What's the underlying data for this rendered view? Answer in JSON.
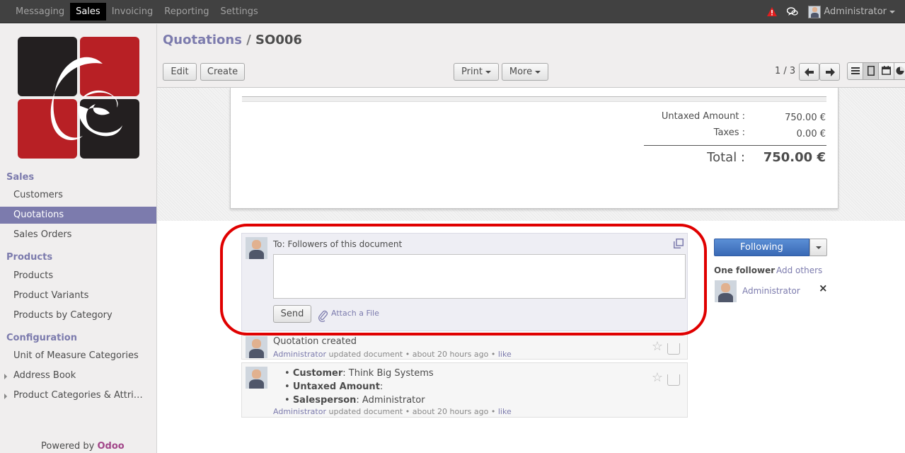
{
  "topbar": {
    "menus": [
      "Messaging",
      "Sales",
      "Invoicing",
      "Reporting",
      "Settings"
    ],
    "user": "Administrator"
  },
  "sidebar": {
    "sections": [
      {
        "title": "Sales",
        "items": [
          "Customers",
          "Quotations",
          "Sales Orders"
        ]
      },
      {
        "title": "Products",
        "items": [
          "Products",
          "Product Variants",
          "Products by Category"
        ]
      },
      {
        "title": "Configuration",
        "items": [
          "Unit of Measure Categories",
          "Address Book",
          "Product Categories & Attri…"
        ]
      }
    ],
    "active_item": "Quotations",
    "powered_prefix": "Powered by",
    "powered_brand": "Odoo"
  },
  "header": {
    "breadcrumb_parent": "Quotations",
    "breadcrumb_sep": "/",
    "breadcrumb_current": "SO006",
    "edit_label": "Edit",
    "create_label": "Create",
    "print_label": "Print",
    "more_label": "More",
    "pager": "1 / 3"
  },
  "totals": {
    "untaxed_label": "Untaxed Amount :",
    "untaxed_value": "750.00 €",
    "taxes_label": "Taxes :",
    "taxes_value": "0.00 €",
    "total_label": "Total :",
    "total_value": "750.00 €"
  },
  "composer": {
    "to_label": "To: Followers of this document",
    "send_label": "Send",
    "attach_label": "Attach a File",
    "message_value": ""
  },
  "messages": [
    {
      "body": "Quotation created",
      "author": "Administrator",
      "action": "updated document",
      "time": "about 20 hours ago",
      "like": "like"
    },
    {
      "lines": [
        {
          "key": "Customer",
          "value": ": Think Big Systems"
        },
        {
          "key": "Untaxed Amount",
          "value": ":"
        },
        {
          "key": "Salesperson",
          "value": ": Administrator"
        }
      ],
      "author": "Administrator",
      "action": "updated document",
      "time": "about 20 hours ago",
      "like": "like"
    }
  ],
  "followers": {
    "follow_button": "Following",
    "count_label": "One follower",
    "add_others": "Add others",
    "list": [
      "Administrator"
    ],
    "remove_glyph": "×"
  },
  "colors": {
    "accent": "#7c7bad",
    "highlight_ring": "#e00000",
    "brand_red": "#b82025",
    "brand_dark": "#231f20"
  }
}
